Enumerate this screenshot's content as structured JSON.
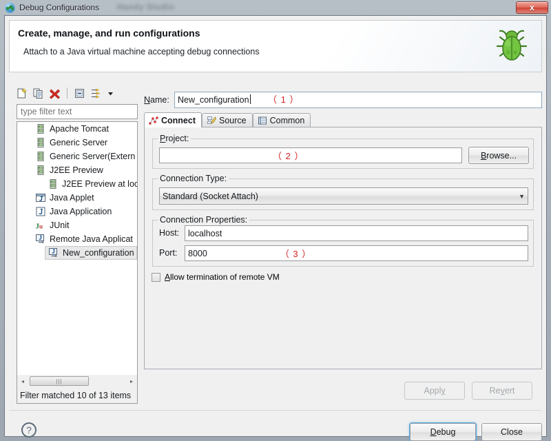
{
  "window": {
    "title": "Debug Configurations",
    "title_icon": "globe-icon",
    "ghost_text": "Handy Studio",
    "close_label": "x"
  },
  "header": {
    "title": "Create, manage, and run configurations",
    "subtitle": "Attach to a Java virtual machine accepting debug connections",
    "icon": "green-bug-icon"
  },
  "tree_toolbar": {
    "items": [
      {
        "name": "new-configuration-icon",
        "tip": "New launch configuration"
      },
      {
        "name": "duplicate-configuration-icon",
        "tip": "Duplicate"
      },
      {
        "name": "delete-configuration-icon",
        "tip": "Delete"
      },
      {
        "name": "collapse-all-icon",
        "tip": "Collapse All"
      },
      {
        "name": "filter-configurations-icon",
        "tip": "Filter"
      },
      {
        "name": "view-menu-chevron-icon",
        "tip": "View Menu"
      }
    ]
  },
  "filter": {
    "placeholder": "type filter text",
    "value": "",
    "status": "Filter matched 10 of 13 items"
  },
  "tree": {
    "items": [
      {
        "label": "Apache Tomcat",
        "icon": "server-icon",
        "indent": 0,
        "selected": false
      },
      {
        "label": "Generic Server",
        "icon": "server-icon",
        "indent": 0,
        "selected": false
      },
      {
        "label": "Generic Server(Extern",
        "icon": "server-icon",
        "indent": 0,
        "selected": false
      },
      {
        "label": "J2EE Preview",
        "icon": "server-icon",
        "indent": 0,
        "selected": false
      },
      {
        "label": "J2EE Preview at loc",
        "icon": "server-icon",
        "indent": 1,
        "selected": false
      },
      {
        "label": "Java Applet",
        "icon": "java-applet-icon",
        "indent": 0,
        "selected": false
      },
      {
        "label": "Java Application",
        "icon": "java-application-icon",
        "indent": 0,
        "selected": false
      },
      {
        "label": "JUnit",
        "icon": "junit-icon",
        "indent": 0,
        "selected": false
      },
      {
        "label": "Remote Java Applicat",
        "icon": "remote-java-application-icon",
        "indent": 0,
        "selected": false
      },
      {
        "label": "New_configuration",
        "icon": "remote-java-application-icon",
        "indent": 1,
        "selected": true
      }
    ]
  },
  "scrollbar": {
    "left_arrow": "◂",
    "right_arrow": "▸",
    "thumb_grip": "|||"
  },
  "name_field": {
    "label": "Name:",
    "value": "New_configuration",
    "annotation": "（ 1 ）"
  },
  "tabs": [
    {
      "label": "Connect",
      "icon": "connect-icon",
      "active": true
    },
    {
      "label": "Source",
      "icon": "source-pencil-icon",
      "active": false
    },
    {
      "label": "Common",
      "icon": "common-list-icon",
      "active": false
    }
  ],
  "connect_tab": {
    "project_group": {
      "title": "Project:",
      "value": "",
      "annotation": "（ 2 ）",
      "browse_label": "Browse..."
    },
    "connection_type": {
      "title": "Connection Type:",
      "selected": "Standard (Socket Attach)",
      "arrow": "▼"
    },
    "connection_properties": {
      "title": "Connection Properties:",
      "host_label": "Host:",
      "host_value": "localhost",
      "port_label": "Port:",
      "port_value": "8000",
      "annotation": "（ 3 ）"
    },
    "allow_termination": {
      "label": "Allow termination of remote VM",
      "checked": false
    }
  },
  "action_buttons": {
    "apply": "Apply",
    "revert": "Revert",
    "apply_enabled": false,
    "revert_enabled": false
  },
  "footer": {
    "help_icon": "help-question-icon",
    "help_glyph": "?",
    "debug": "Debug",
    "close": "Close"
  },
  "colors": {
    "annotation_red": "#d21f1f",
    "default_button_focus": "#5aa9e0",
    "selection_gray": "#e8e8e8",
    "bug_green": "#5aa430"
  }
}
